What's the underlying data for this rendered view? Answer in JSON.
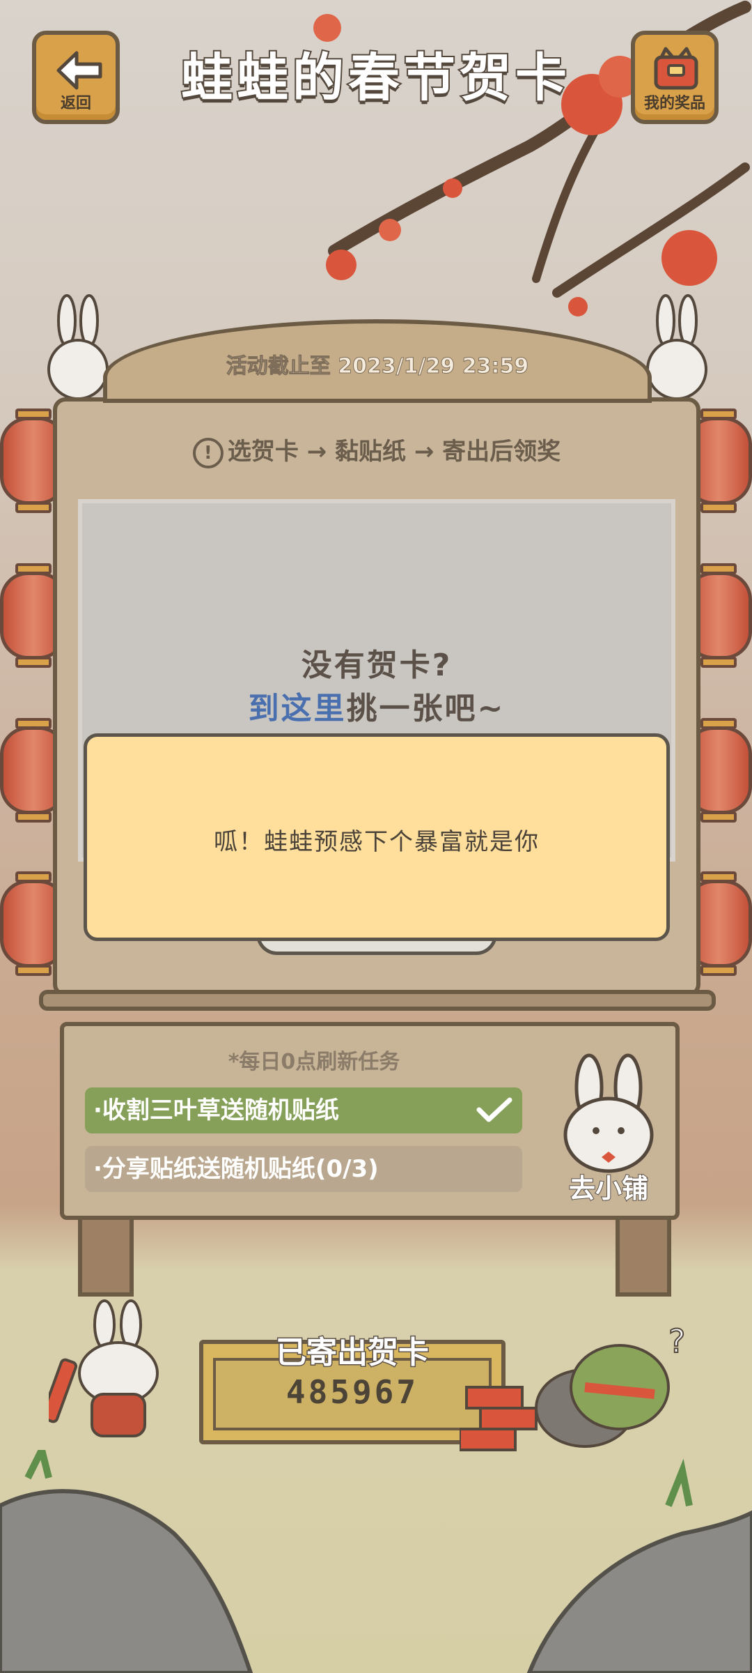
{
  "header": {
    "title": "蛙蛙的春节贺卡",
    "back_label": "返回",
    "prizes_label": "我的奖品"
  },
  "board": {
    "deadline": "活动截止至 2023/1/29 23:59",
    "steps_icon": "!",
    "steps": "选贺卡 → 黏贴纸 → 寄出后领奖",
    "empty_title": "没有贺卡?",
    "pick_link": "到这里",
    "pick_rest": "挑一张吧~"
  },
  "toast": {
    "message": "呱！蛙蛙预感下个暴富就是你"
  },
  "tasks": {
    "refresh_note": "*每日0点刷新任务",
    "items": [
      {
        "label": "·收割三叶草送随机贴纸",
        "done": true
      },
      {
        "label": "·分享贴纸送随机贴纸(0/3)",
        "done": false
      }
    ],
    "shop_label": "去小铺"
  },
  "sent": {
    "title": "已寄出贺卡",
    "count": "485967"
  },
  "colors": {
    "wood_dark": "#6b5b44",
    "board": "#c9b59a",
    "toast_bg": "#ffdf9b",
    "task_done": "#86a05a",
    "link_blue": "#4a6fae",
    "lantern_red": "#c4513a"
  }
}
